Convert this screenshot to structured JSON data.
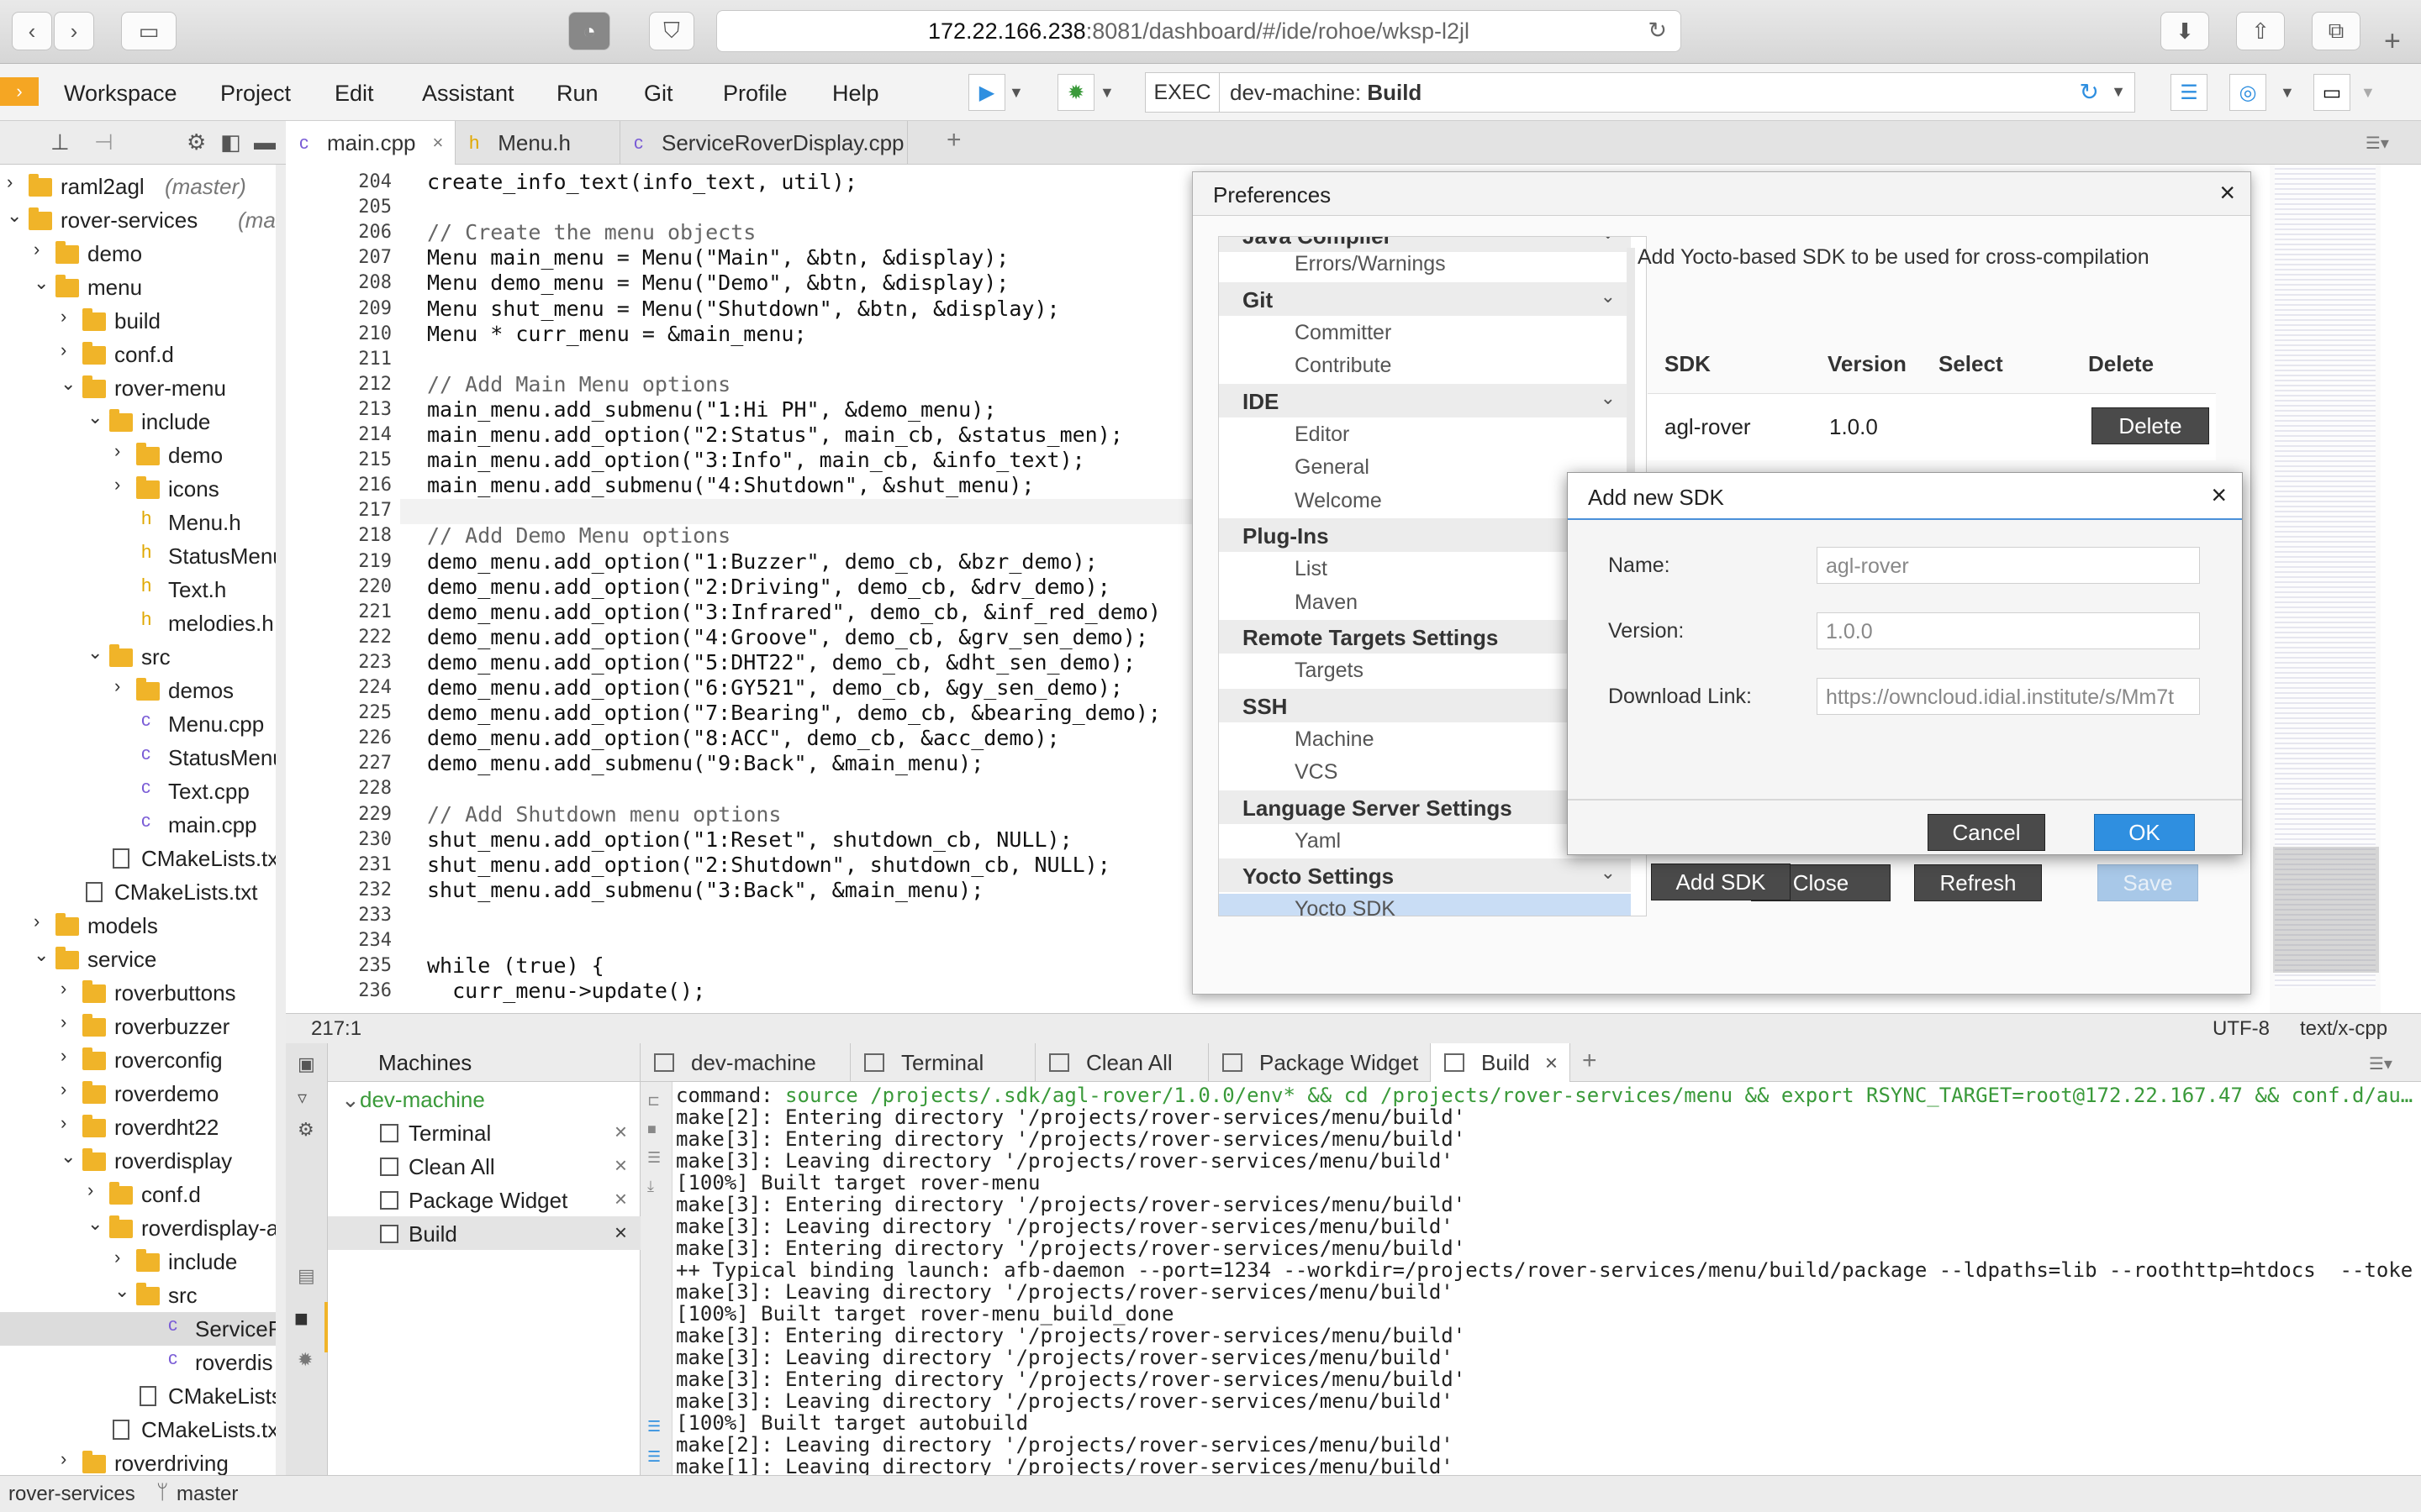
{
  "browser": {
    "url_host": "172.22.166.238",
    "url_path": ":8081/dashboard/#/ide/rohoe/wksp-l2jl"
  },
  "menubar": {
    "items": [
      "Workspace",
      "Project",
      "Edit",
      "Assistant",
      "Run",
      "Git",
      "Profile",
      "Help"
    ]
  },
  "exec": {
    "label": "EXEC",
    "machine": "dev-machine:",
    "command": "Build"
  },
  "editor_tabs": [
    {
      "label": "main.cpp",
      "type": "cpp",
      "active": true
    },
    {
      "label": "Menu.h",
      "type": "h",
      "active": false
    },
    {
      "label": "ServiceRoverDisplay.cpp",
      "type": "cpp",
      "active": false
    }
  ],
  "tree": [
    {
      "label": "raml2agl",
      "branch": "(master)",
      "level": 0,
      "kind": "project",
      "arrow": "right"
    },
    {
      "label": "rover-services",
      "branch": "(master)",
      "level": 0,
      "kind": "project",
      "arrow": "down"
    },
    {
      "label": "demo",
      "level": 1,
      "kind": "folder",
      "arrow": "right"
    },
    {
      "label": "menu",
      "level": 1,
      "kind": "project",
      "arrow": "down"
    },
    {
      "label": "build",
      "level": 2,
      "kind": "folder",
      "arrow": "right"
    },
    {
      "label": "conf.d",
      "level": 2,
      "kind": "folder",
      "arrow": "right"
    },
    {
      "label": "rover-menu",
      "level": 2,
      "kind": "folder",
      "arrow": "down"
    },
    {
      "label": "include",
      "level": 3,
      "kind": "folder",
      "arrow": "down"
    },
    {
      "label": "demo",
      "level": 4,
      "kind": "folder",
      "arrow": "right"
    },
    {
      "label": "icons",
      "level": 4,
      "kind": "folder",
      "arrow": "right"
    },
    {
      "label": "Menu.h",
      "level": 4,
      "kind": "h"
    },
    {
      "label": "StatusMenu",
      "level": 4,
      "kind": "h"
    },
    {
      "label": "Text.h",
      "level": 4,
      "kind": "h"
    },
    {
      "label": "melodies.h",
      "level": 4,
      "kind": "h"
    },
    {
      "label": "src",
      "level": 3,
      "kind": "folder",
      "arrow": "down"
    },
    {
      "label": "demos",
      "level": 4,
      "kind": "folder",
      "arrow": "right"
    },
    {
      "label": "Menu.cpp",
      "level": 4,
      "kind": "cpp"
    },
    {
      "label": "StatusMenu",
      "level": 4,
      "kind": "cpp"
    },
    {
      "label": "Text.cpp",
      "level": 4,
      "kind": "cpp"
    },
    {
      "label": "main.cpp",
      "level": 4,
      "kind": "cpp"
    },
    {
      "label": "CMakeLists.txt",
      "level": 3,
      "kind": "txt"
    },
    {
      "label": "CMakeLists.txt",
      "level": 2,
      "kind": "txt"
    },
    {
      "label": "models",
      "level": 1,
      "kind": "folder",
      "arrow": "right"
    },
    {
      "label": "service",
      "level": 1,
      "kind": "project",
      "arrow": "down"
    },
    {
      "label": "roverbuttons",
      "level": 2,
      "kind": "folder",
      "arrow": "right"
    },
    {
      "label": "roverbuzzer",
      "level": 2,
      "kind": "folder",
      "arrow": "right"
    },
    {
      "label": "roverconfig",
      "level": 2,
      "kind": "folder",
      "arrow": "right"
    },
    {
      "label": "roverdemo",
      "level": 2,
      "kind": "folder",
      "arrow": "right"
    },
    {
      "label": "roverdht22",
      "level": 2,
      "kind": "folder",
      "arrow": "right"
    },
    {
      "label": "roverdisplay",
      "level": 2,
      "kind": "folder",
      "arrow": "down"
    },
    {
      "label": "conf.d",
      "level": 3,
      "kind": "folder",
      "arrow": "right"
    },
    {
      "label": "roverdisplay-a",
      "level": 3,
      "kind": "folder",
      "arrow": "down"
    },
    {
      "label": "include",
      "level": 4,
      "kind": "folder",
      "arrow": "right"
    },
    {
      "label": "src",
      "level": 4,
      "kind": "folder",
      "arrow": "down"
    },
    {
      "label": "ServiceR",
      "level": 5,
      "kind": "cpp",
      "selected": true
    },
    {
      "label": "roverdis",
      "level": 5,
      "kind": "cpp"
    },
    {
      "label": "CMakeLists",
      "level": 4,
      "kind": "txt"
    },
    {
      "label": "CMakeLists.txt",
      "level": 3,
      "kind": "txt"
    },
    {
      "label": "roverdriving",
      "level": 2,
      "kind": "folder",
      "arrow": "right"
    }
  ],
  "code": [
    {
      "n": "204",
      "t": "create_info_text(info_text, util);"
    },
    {
      "n": "205",
      "t": ""
    },
    {
      "n": "206",
      "t": "// Create the menu objects",
      "c": true
    },
    {
      "n": "207",
      "t": "Menu main_menu = Menu(\"Main\", &btn, &display);"
    },
    {
      "n": "208",
      "t": "Menu demo_menu = Menu(\"Demo\", &btn, &display);"
    },
    {
      "n": "209",
      "t": "Menu shut_menu = Menu(\"Shutdown\", &btn, &display);"
    },
    {
      "n": "210",
      "t": "Menu * curr_menu = &main_menu;"
    },
    {
      "n": "211",
      "t": ""
    },
    {
      "n": "212",
      "t": "// Add Main Menu options",
      "c": true
    },
    {
      "n": "213",
      "t": "main_menu.add_submenu(\"1:Hi PH\", &demo_menu);"
    },
    {
      "n": "214",
      "t": "main_menu.add_option(\"2:Status\", main_cb, &status_men);"
    },
    {
      "n": "215",
      "t": "main_menu.add_option(\"3:Info\", main_cb, &info_text);"
    },
    {
      "n": "216",
      "t": "main_menu.add_submenu(\"4:Shutdown\", &shut_menu);"
    },
    {
      "n": "217",
      "t": ""
    },
    {
      "n": "218",
      "t": "// Add Demo Menu options",
      "c": true
    },
    {
      "n": "219",
      "t": "demo_menu.add_option(\"1:Buzzer\", demo_cb, &bzr_demo);"
    },
    {
      "n": "220",
      "t": "demo_menu.add_option(\"2:Driving\", demo_cb, &drv_demo);"
    },
    {
      "n": "221",
      "t": "demo_menu.add_option(\"3:Infrared\", demo_cb, &inf_red_demo)"
    },
    {
      "n": "222",
      "t": "demo_menu.add_option(\"4:Groove\", demo_cb, &grv_sen_demo);"
    },
    {
      "n": "223",
      "t": "demo_menu.add_option(\"5:DHT22\", demo_cb, &dht_sen_demo);"
    },
    {
      "n": "224",
      "t": "demo_menu.add_option(\"6:GY521\", demo_cb, &gy_sen_demo);"
    },
    {
      "n": "225",
      "t": "demo_menu.add_option(\"7:Bearing\", demo_cb, &bearing_demo);"
    },
    {
      "n": "226",
      "t": "demo_menu.add_option(\"8:ACC\", demo_cb, &acc_demo);"
    },
    {
      "n": "227",
      "t": "demo_menu.add_submenu(\"9:Back\", &main_menu);"
    },
    {
      "n": "228",
      "t": ""
    },
    {
      "n": "229",
      "t": "// Add Shutdown menu options",
      "c": true
    },
    {
      "n": "230",
      "t": "shut_menu.add_option(\"1:Reset\", shutdown_cb, NULL);"
    },
    {
      "n": "231",
      "t": "shut_menu.add_option(\"2:Shutdown\", shutdown_cb, NULL);"
    },
    {
      "n": "232",
      "t": "shut_menu.add_submenu(\"3:Back\", &main_menu);"
    },
    {
      "n": "233",
      "t": ""
    },
    {
      "n": "234",
      "t": ""
    },
    {
      "n": "235",
      "t": "while (true) {"
    },
    {
      "n": "236",
      "t": "  curr_menu->update();"
    }
  ],
  "editor_status": {
    "position": "217:1",
    "encoding": "UTF-8",
    "mime": "text/x-cpp"
  },
  "machines": {
    "title": "Machines",
    "machine": "dev-machine",
    "items": [
      "Terminal",
      "Clean All",
      "Package Widget",
      "Build"
    ]
  },
  "output_tabs": [
    "dev-machine",
    "Terminal",
    "Clean All",
    "Package Widget",
    "Build"
  ],
  "output": {
    "cmd_label": "command:",
    "cmd": " source /projects/.sdk/agl-rover/1.0.0/env* && cd /projects/rover-services/menu && export RSYNC_TARGET=root@172.22.167.47 && conf.d/au…",
    "lines": [
      "make[2]: Entering directory '/projects/rover-services/menu/build'",
      "make[3]: Entering directory '/projects/rover-services/menu/build'",
      "make[3]: Leaving directory '/projects/rover-services/menu/build'",
      "[100%] Built target rover-menu",
      "make[3]: Entering directory '/projects/rover-services/menu/build'",
      "make[3]: Leaving directory '/projects/rover-services/menu/build'",
      "make[3]: Entering directory '/projects/rover-services/menu/build'",
      "++ Typical binding launch: afb-daemon --port=1234 --workdir=/projects/rover-services/menu/build/package --ldpaths=lib --roothttp=htdocs  --toke",
      "make[3]: Leaving directory '/projects/rover-services/menu/build'",
      "[100%] Built target rover-menu_build_done",
      "make[3]: Entering directory '/projects/rover-services/menu/build'",
      "make[3]: Leaving directory '/projects/rover-services/menu/build'",
      "make[3]: Entering directory '/projects/rover-services/menu/build'",
      "make[3]: Leaving directory '/projects/rover-services/menu/build'",
      "[100%] Built target autobuild",
      "make[2]: Leaving directory '/projects/rover-services/menu/build'",
      "make[1]: Leaving directory '/projects/rover-services/menu/build'"
    ]
  },
  "bottom_status": {
    "project": "rover-services",
    "branch": "master"
  },
  "preferences": {
    "title": "Preferences",
    "nav": [
      {
        "type": "item",
        "label": "Errors/Warnings"
      },
      {
        "type": "group",
        "label": "Git"
      },
      {
        "type": "item",
        "label": "Committer"
      },
      {
        "type": "item",
        "label": "Contribute"
      },
      {
        "type": "group",
        "label": "IDE"
      },
      {
        "type": "item",
        "label": "Editor"
      },
      {
        "type": "item",
        "label": "General"
      },
      {
        "type": "item",
        "label": "Welcome"
      },
      {
        "type": "group",
        "label": "Plug-Ins"
      },
      {
        "type": "item",
        "label": "List"
      },
      {
        "type": "item",
        "label": "Maven"
      },
      {
        "type": "group",
        "label": "Remote Targets Settings"
      },
      {
        "type": "item",
        "label": "Targets"
      },
      {
        "type": "group",
        "label": "SSH"
      },
      {
        "type": "item",
        "label": "Machine"
      },
      {
        "type": "item",
        "label": "VCS"
      },
      {
        "type": "group",
        "label": "Language Server Settings"
      },
      {
        "type": "item",
        "label": "Yaml"
      },
      {
        "type": "group",
        "label": "Yocto Settings"
      },
      {
        "type": "item",
        "label": "Yocto SDK",
        "selected": true
      }
    ],
    "nav_partial": "Java Compiler",
    "description": "Add Yocto-based SDK to be used for cross-compilation",
    "table_headers": [
      "SDK",
      "Version",
      "Select",
      "Delete"
    ],
    "row": {
      "sdk": "agl-rover",
      "version": "1.0.0",
      "delete": "Delete"
    },
    "add_sdk": "Add SDK",
    "close": "Close",
    "refresh": "Refresh",
    "save": "Save"
  },
  "add_sdk_dialog": {
    "title": "Add new SDK",
    "name_label": "Name:",
    "name_value": "agl-rover",
    "version_label": "Version:",
    "version_value": "1.0.0",
    "link_label": "Download Link:",
    "link_value": "https://owncloud.idial.institute/s/Mm7t",
    "cancel": "Cancel",
    "ok": "OK"
  }
}
